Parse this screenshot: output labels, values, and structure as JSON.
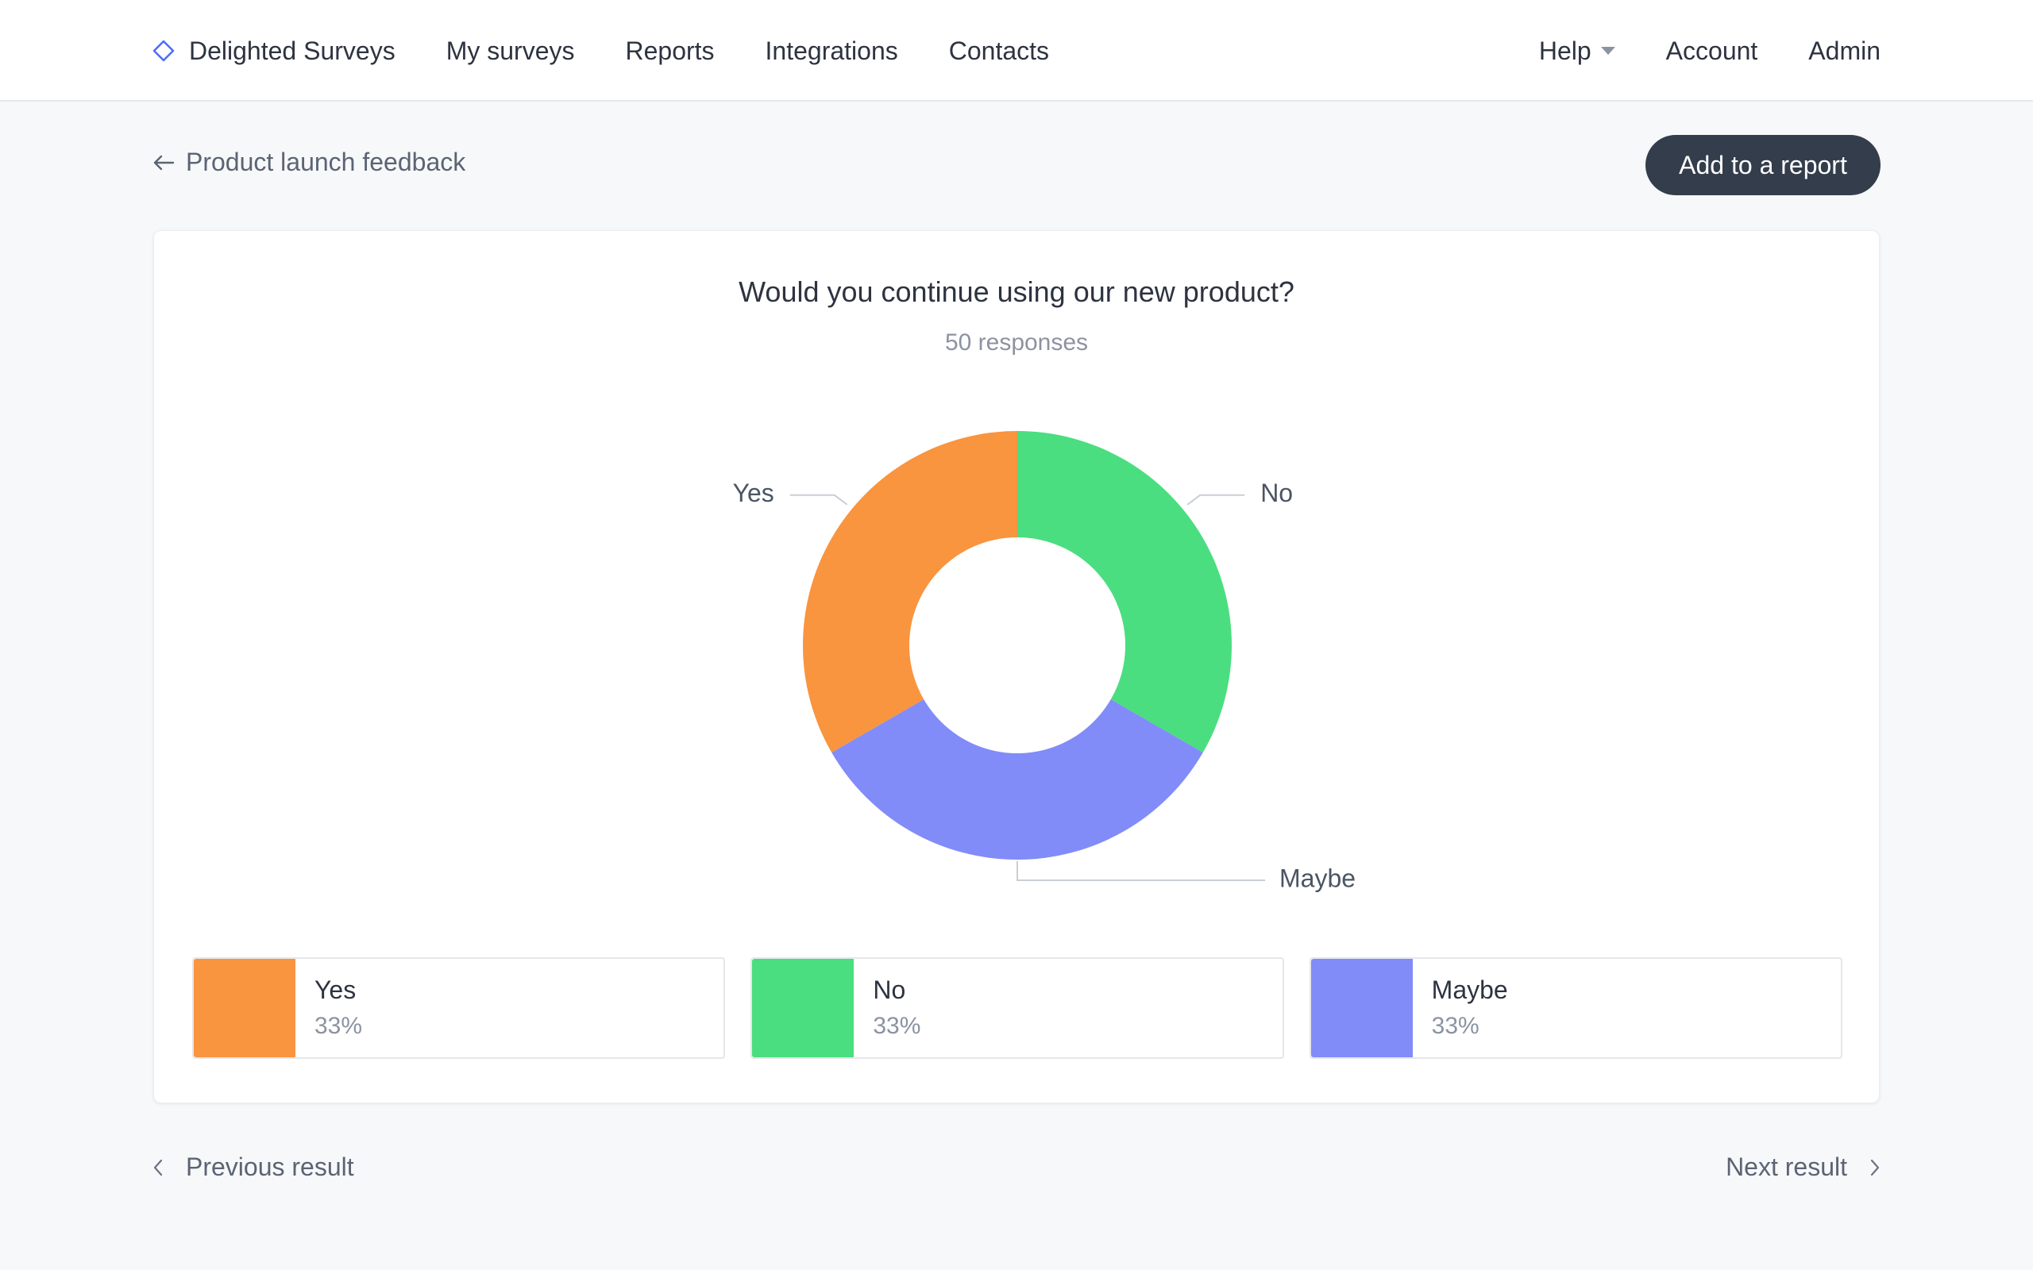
{
  "nav": {
    "brand": "Delighted Surveys",
    "brand_icon": "diamond-logo-icon",
    "links": [
      "My surveys",
      "Reports",
      "Integrations",
      "Contacts"
    ],
    "help": "Help",
    "account": "Account",
    "admin": "Admin"
  },
  "subheader": {
    "back_label": "Product launch feedback",
    "action_button": "Add to a report"
  },
  "question": {
    "title": "Would you continue using our new product?",
    "responses": "50 responses"
  },
  "chart_data": {
    "type": "pie",
    "donut": true,
    "categories": [
      "Yes",
      "No",
      "Maybe"
    ],
    "values": [
      33.33,
      33.33,
      33.33
    ],
    "colors": [
      "#f9943f",
      "#4ade80",
      "#818cf8"
    ],
    "labels": [
      "Yes",
      "No",
      "Maybe"
    ]
  },
  "legend": [
    {
      "label": "Yes",
      "pct": "33%",
      "color": "#f9943f"
    },
    {
      "label": "No",
      "pct": "33%",
      "color": "#4ade80"
    },
    {
      "label": "Maybe",
      "pct": "33%",
      "color": "#818cf8"
    }
  ],
  "pager": {
    "prev": "Previous result",
    "next": "Next result"
  },
  "colors": {
    "accent_dark": "#343d4c",
    "brand_blue": "#4f6ef7"
  }
}
